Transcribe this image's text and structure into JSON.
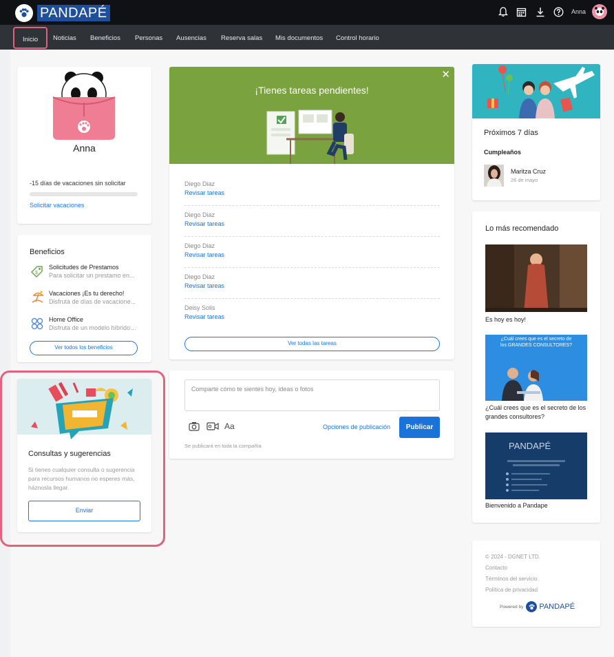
{
  "header": {
    "logo": "PANDAPÉ",
    "user_name": "Anna"
  },
  "nav": {
    "items": [
      "Inicio",
      "Noticias",
      "Beneficios",
      "Personas",
      "Ausencias",
      "Reserva salas",
      "Mis documentos",
      "Control horario"
    ],
    "active": "Inicio"
  },
  "profile": {
    "name": "Anna",
    "vacation_text": "-15 días de vacaciones sin solicitar",
    "vacation_progress": 0,
    "request_link": "Solicitar vacaciones"
  },
  "benefits": {
    "title": "Beneficios",
    "items": [
      {
        "title": "Solicitudes de Prestamos",
        "desc": "Para solicitar un prestamo en...",
        "icon": "tag-icon"
      },
      {
        "title": "Vacaciones ¡Es tu derecho!",
        "desc": "Disfruta de días de vacacione...",
        "icon": "beach-icon"
      },
      {
        "title": "Home Office",
        "desc": "Disfruta de un modelo híbrido,...",
        "icon": "home-office-icon"
      }
    ],
    "see_all": "Ver todos los beneficios"
  },
  "consultas": {
    "title": "Consultas y sugerencias",
    "desc": "Si tienes cualquier consulta o sugerencia para recursos humanos no esperes más, háznosla llegar.",
    "button": "Enviar"
  },
  "tasks": {
    "title": "¡Tienes tareas pendientes!",
    "items": [
      {
        "name": "Diego Diaz",
        "link": "Revisar tareas"
      },
      {
        "name": "Diego Diaz",
        "link": "Revisar tareas"
      },
      {
        "name": "Diego Diaz",
        "link": "Revisar tareas"
      },
      {
        "name": "Diego Diaz",
        "link": "Revisar tareas"
      },
      {
        "name": "Deisy Solis",
        "link": "Revisar tareas"
      }
    ],
    "see_all": "Ver todas las tareas"
  },
  "post": {
    "placeholder": "Comparte cómo te sientes hoy, ideas o fotos",
    "text_format": "Aa",
    "options": "Opciones de publicación",
    "publish": "Publicar",
    "scope_note": "Se publicará en toda la compañía"
  },
  "upcoming": {
    "title": "Próximos 7 días",
    "birthdays_label": "Cumpleaños",
    "person_name": "Maritza Cruz",
    "person_date": "26 de mayo"
  },
  "recommended": {
    "title": "Lo más recomendado",
    "items": [
      {
        "caption": "Es hoy es hoy!"
      },
      {
        "caption": "¿Cuál crees que es el secreto de los grandes consultores?",
        "image_text": "¿Cuál crees que es el secreto de los GRANDES CONSULTORES?"
      },
      {
        "caption": "Bienvenido a Pandape",
        "image_text": "PANDAPÉ"
      }
    ]
  },
  "footer": {
    "copyright": "© 2024 - DGNET LTD.",
    "links": [
      "Contacto",
      "Términos del servicio",
      "Política de privacidad"
    ],
    "powered_by": "Powered by",
    "brand": "PANDAPÉ"
  }
}
